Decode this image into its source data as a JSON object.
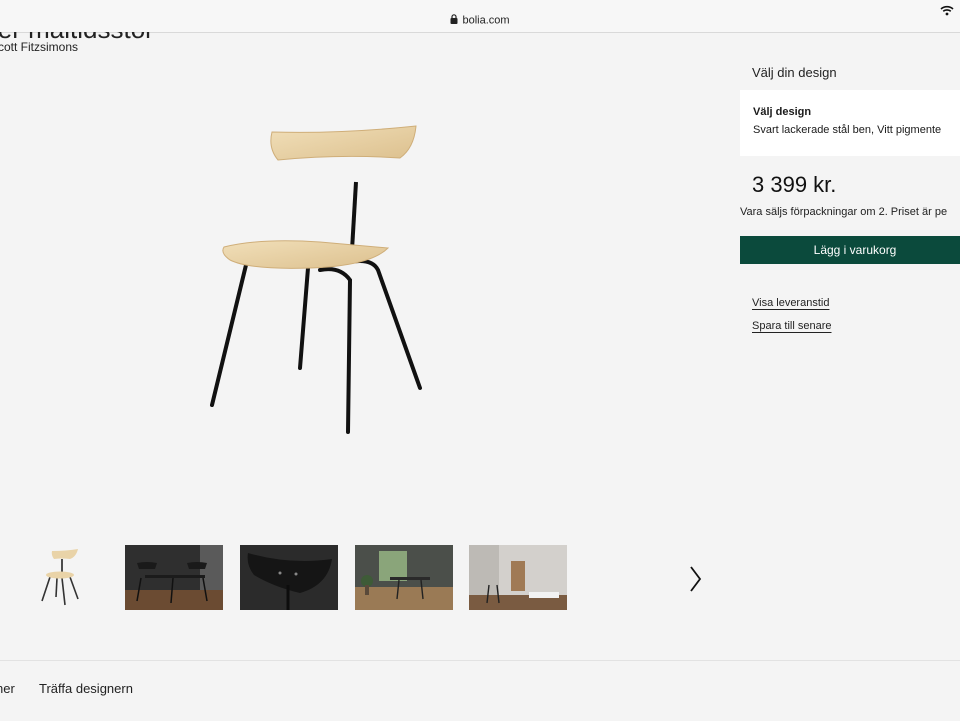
{
  "browser": {
    "url": "bolia.com"
  },
  "product": {
    "title": "ler måltidsstol",
    "designer": "cott Fitzsimons"
  },
  "gallery": {
    "thumbnails": [
      "chair-thumb",
      "dining-thumb",
      "backrest-thumb",
      "room-thumb",
      "corner-thumb"
    ]
  },
  "bottom_tabs": [
    "ner",
    "Träffa designern"
  ],
  "sidebar": {
    "choose_heading": "Välj din design",
    "design_label": "Välj design",
    "design_value": "Svart lackerade stål ben, Vitt pigmente",
    "price": "3 399 kr.",
    "pack_note": "Vara säljs förpackningar om 2. Priset är pe",
    "add_to_cart": "Lägg i varukorg",
    "links": {
      "delivery": "Visa leveranstid",
      "save": "Spara till senare"
    }
  },
  "colors": {
    "accent": "#0b4a3c",
    "background": "#f4f4f4",
    "wood": "#e9d3a8"
  }
}
